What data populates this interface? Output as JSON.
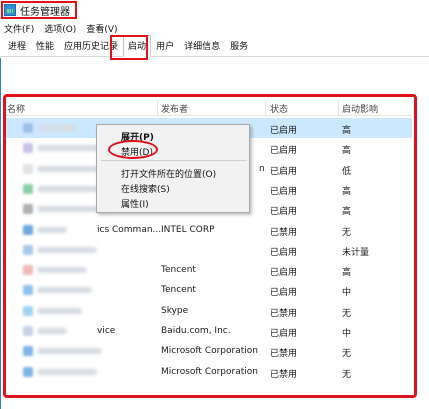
{
  "window": {
    "title": "任务管理器"
  },
  "menu": [
    "文件(F)",
    "选项(O)",
    "查看(V)"
  ],
  "tabs": [
    "进程",
    "性能",
    "应用历史记录",
    "启动",
    "用户",
    "详细信息",
    "服务"
  ],
  "active_tab": "启动",
  "columns": {
    "name": "名称",
    "publisher": "发布者",
    "status": "状态",
    "impact": "启动影响"
  },
  "rows": [
    {
      "name": "",
      "publisher": "",
      "status": "已启用",
      "impact": "高",
      "icon_color": "#9fc3e6"
    },
    {
      "name": "",
      "publisher": "",
      "status": "已启用",
      "impact": "高",
      "icon_color": "#c7c2e8"
    },
    {
      "name": "",
      "publisher": "n",
      "status": "已启用",
      "impact": "低",
      "icon_color": "#e3e3e3"
    },
    {
      "name": "",
      "publisher": "",
      "status": "已启用",
      "impact": "高",
      "icon_color": "#8bd0a4"
    },
    {
      "name": "",
      "publisher": "",
      "status": "已启用",
      "impact": "高",
      "icon_color": "#b0b0b0"
    },
    {
      "name": "ics Comman...",
      "publisher": "INTEL CORP",
      "status": "已禁用",
      "impact": "无",
      "icon_color": "#6fa8dc"
    },
    {
      "name": "",
      "publisher": "",
      "status": "已启用",
      "impact": "未计量",
      "icon_color": "#a9c9ea"
    },
    {
      "name": "",
      "publisher": "Tencent",
      "status": "已启用",
      "impact": "高",
      "icon_color": "#f2b9b9"
    },
    {
      "name": "",
      "publisher": "Tencent",
      "status": "已启用",
      "impact": "中",
      "icon_color": "#8fc0ee"
    },
    {
      "name": "",
      "publisher": "Skype",
      "status": "已禁用",
      "impact": "无",
      "icon_color": "#9fd3f2"
    },
    {
      "name": "vice",
      "publisher": "Baidu.com, Inc.",
      "status": "已启用",
      "impact": "中",
      "icon_color": "#c9d4e2"
    },
    {
      "name": "",
      "publisher": "Microsoft Corporation",
      "status": "已禁用",
      "impact": "无",
      "icon_color": "#7fb4e6"
    },
    {
      "name": "",
      "publisher": "Microsoft Corporation",
      "status": "已禁用",
      "impact": "无",
      "icon_color": "#7fb4e6"
    }
  ],
  "context_menu": {
    "expand": "展开(P)",
    "disable": "禁用(D)",
    "open_location": "打开文件所在的位置(O)",
    "search_online": "在线搜索(S)",
    "properties": "属性(I)"
  },
  "highlight_color": "#e0121b",
  "selection_color": "#cce8ff"
}
